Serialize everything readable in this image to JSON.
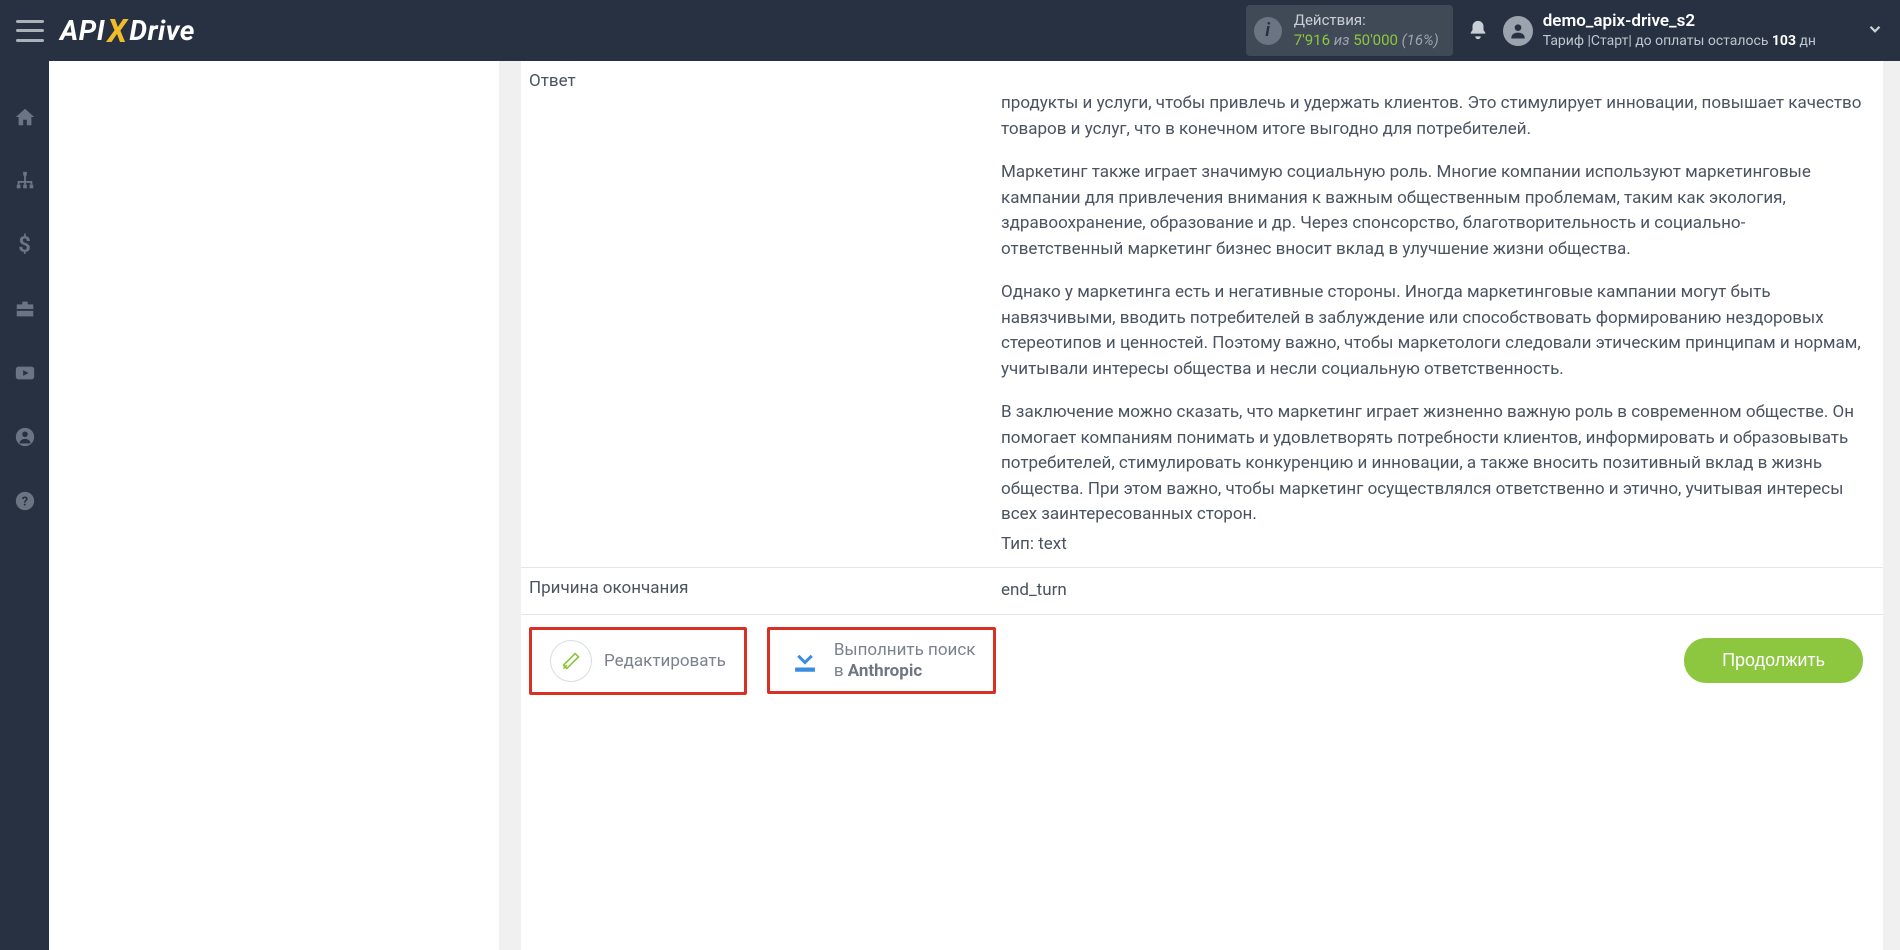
{
  "header": {
    "actions_label": "Действия:",
    "actions_used": "7'916",
    "actions_of": " из ",
    "actions_total": "50'000",
    "actions_pct": " (16%)",
    "username": "demo_apix-drive_s2",
    "tariff_prefix": "Тариф |Старт| до оплаты осталось ",
    "tariff_days": "103",
    "tariff_suffix": " дн"
  },
  "logo": {
    "api": "API",
    "x": "X",
    "drive": "Drive"
  },
  "content": {
    "answer_label": "Ответ",
    "answer_p1": "продукты и услуги, чтобы привлечь и удержать клиентов. Это стимулирует инновации, повышает качество товаров и услуг, что в конечном итоге выгодно для потребителей.",
    "answer_p2": "Маркетинг также играет значимую социальную роль. Многие компании используют маркетинговые кампании для привлечения внимания к важным общественным проблемам, таким как экология, здравоохранение, образование и др. Через спонсорство, благотворительность и социально-ответственный маркетинг бизнес вносит вклад в улучшение жизни общества.",
    "answer_p3": "Однако у маркетинга есть и негативные стороны. Иногда маркетинговые кампании могут быть навязчивыми, вводить потребителей в заблуждение или способствовать формированию нездоровых стереотипов и ценностей. Поэтому важно, чтобы маркетологи следовали этическим принципам и нормам, учитывали интересы общества и несли социальную ответственность.",
    "answer_p4": "В заключение можно сказать, что маркетинг играет жизненно важную роль в современном обществе. Он помогает компаниям понимать и удовлетворять потребности клиентов, информировать и образовывать потребителей, стимулировать конкуренцию и инновации, а также вносить позитивный вклад в жизнь общества. При этом важно, чтобы маркетинг осуществлялся ответственно и этично, учитывая интересы всех заинтересованных сторон.",
    "answer_type": "Тип: text",
    "reason_label": "Причина окончания",
    "reason_value": "end_turn"
  },
  "actions": {
    "edit": "Редактировать",
    "search_line1": "Выполнить поиск",
    "search_line2_prefix": "в ",
    "search_line2_brand": "Anthropic",
    "continue": "Продолжить"
  }
}
